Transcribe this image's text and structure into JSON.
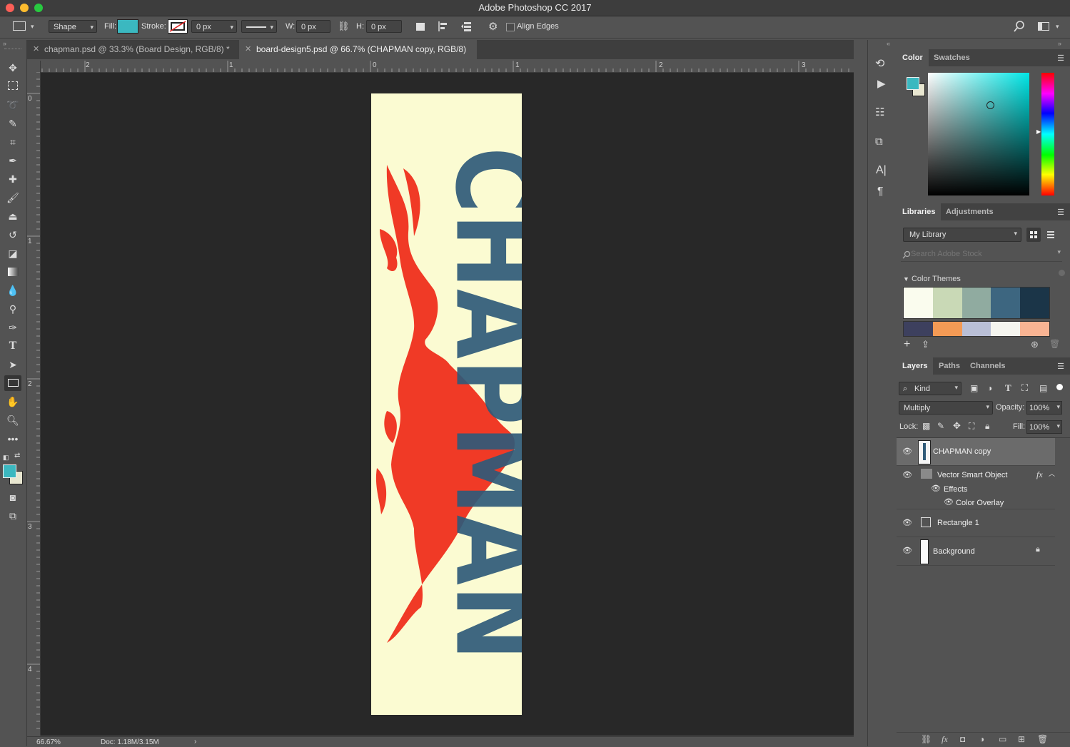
{
  "window": {
    "title": "Adobe Photoshop CC 2017"
  },
  "options_bar": {
    "mode": "Shape",
    "fill_label": "Fill:",
    "fill_color": "#3bb8c0",
    "stroke_label": "Stroke:",
    "stroke_width": "0 px",
    "w_label": "W:",
    "w_value": "0 px",
    "h_label": "H:",
    "h_value": "0 px",
    "align_edges": "Align Edges"
  },
  "tabs": [
    {
      "label": "chapman.psd @ 33.3% (Board Design, RGB/8) *"
    },
    {
      "label": "board-design5.psd @ 66.7% (CHAPMAN copy, RGB/8)"
    }
  ],
  "ruler": {
    "top": [
      "2",
      "1",
      "0",
      "1",
      "2",
      "3"
    ],
    "left": [
      "0",
      "1",
      "2",
      "3",
      "4"
    ]
  },
  "canvas": {
    "word": "CHAPMAN",
    "paper_color": "#fbfbd2",
    "text_color": "#2f5a78",
    "flame_color": "#f03a26"
  },
  "status": {
    "zoom": "66.67%",
    "doc": "Doc: 1.18M/3.15M"
  },
  "color_panel": {
    "tabs": [
      "Color",
      "Swatches"
    ],
    "foreground": "#3bb8c0",
    "background": "#e8e6d0"
  },
  "libraries_panel": {
    "tabs": [
      "Libraries",
      "Adjustments"
    ],
    "library_name": "My Library",
    "search_placeholder": "Search Adobe Stock",
    "section": "Color Themes",
    "theme1": [
      "#fafcee",
      "#c9d9b6",
      "#90aba0",
      "#3d6680",
      "#1b3548"
    ],
    "theme2": [
      "#3d405e",
      "#f39a55",
      "#b9bfd6",
      "#f5f5ef",
      "#f9b493"
    ]
  },
  "layers_panel": {
    "tabs": [
      "Layers",
      "Paths",
      "Channels"
    ],
    "filter": "Kind",
    "blend_mode": "Multiply",
    "opacity_label": "Opacity:",
    "opacity": "100%",
    "lock_label": "Lock:",
    "fill_label": "Fill:",
    "fill": "100%",
    "layers": [
      {
        "name": "CHAPMAN copy"
      },
      {
        "name": "Vector Smart Object",
        "fx": "fx"
      },
      {
        "name": "Effects"
      },
      {
        "name": "Color Overlay"
      },
      {
        "name": "Rectangle 1"
      },
      {
        "name": "Background"
      }
    ]
  }
}
